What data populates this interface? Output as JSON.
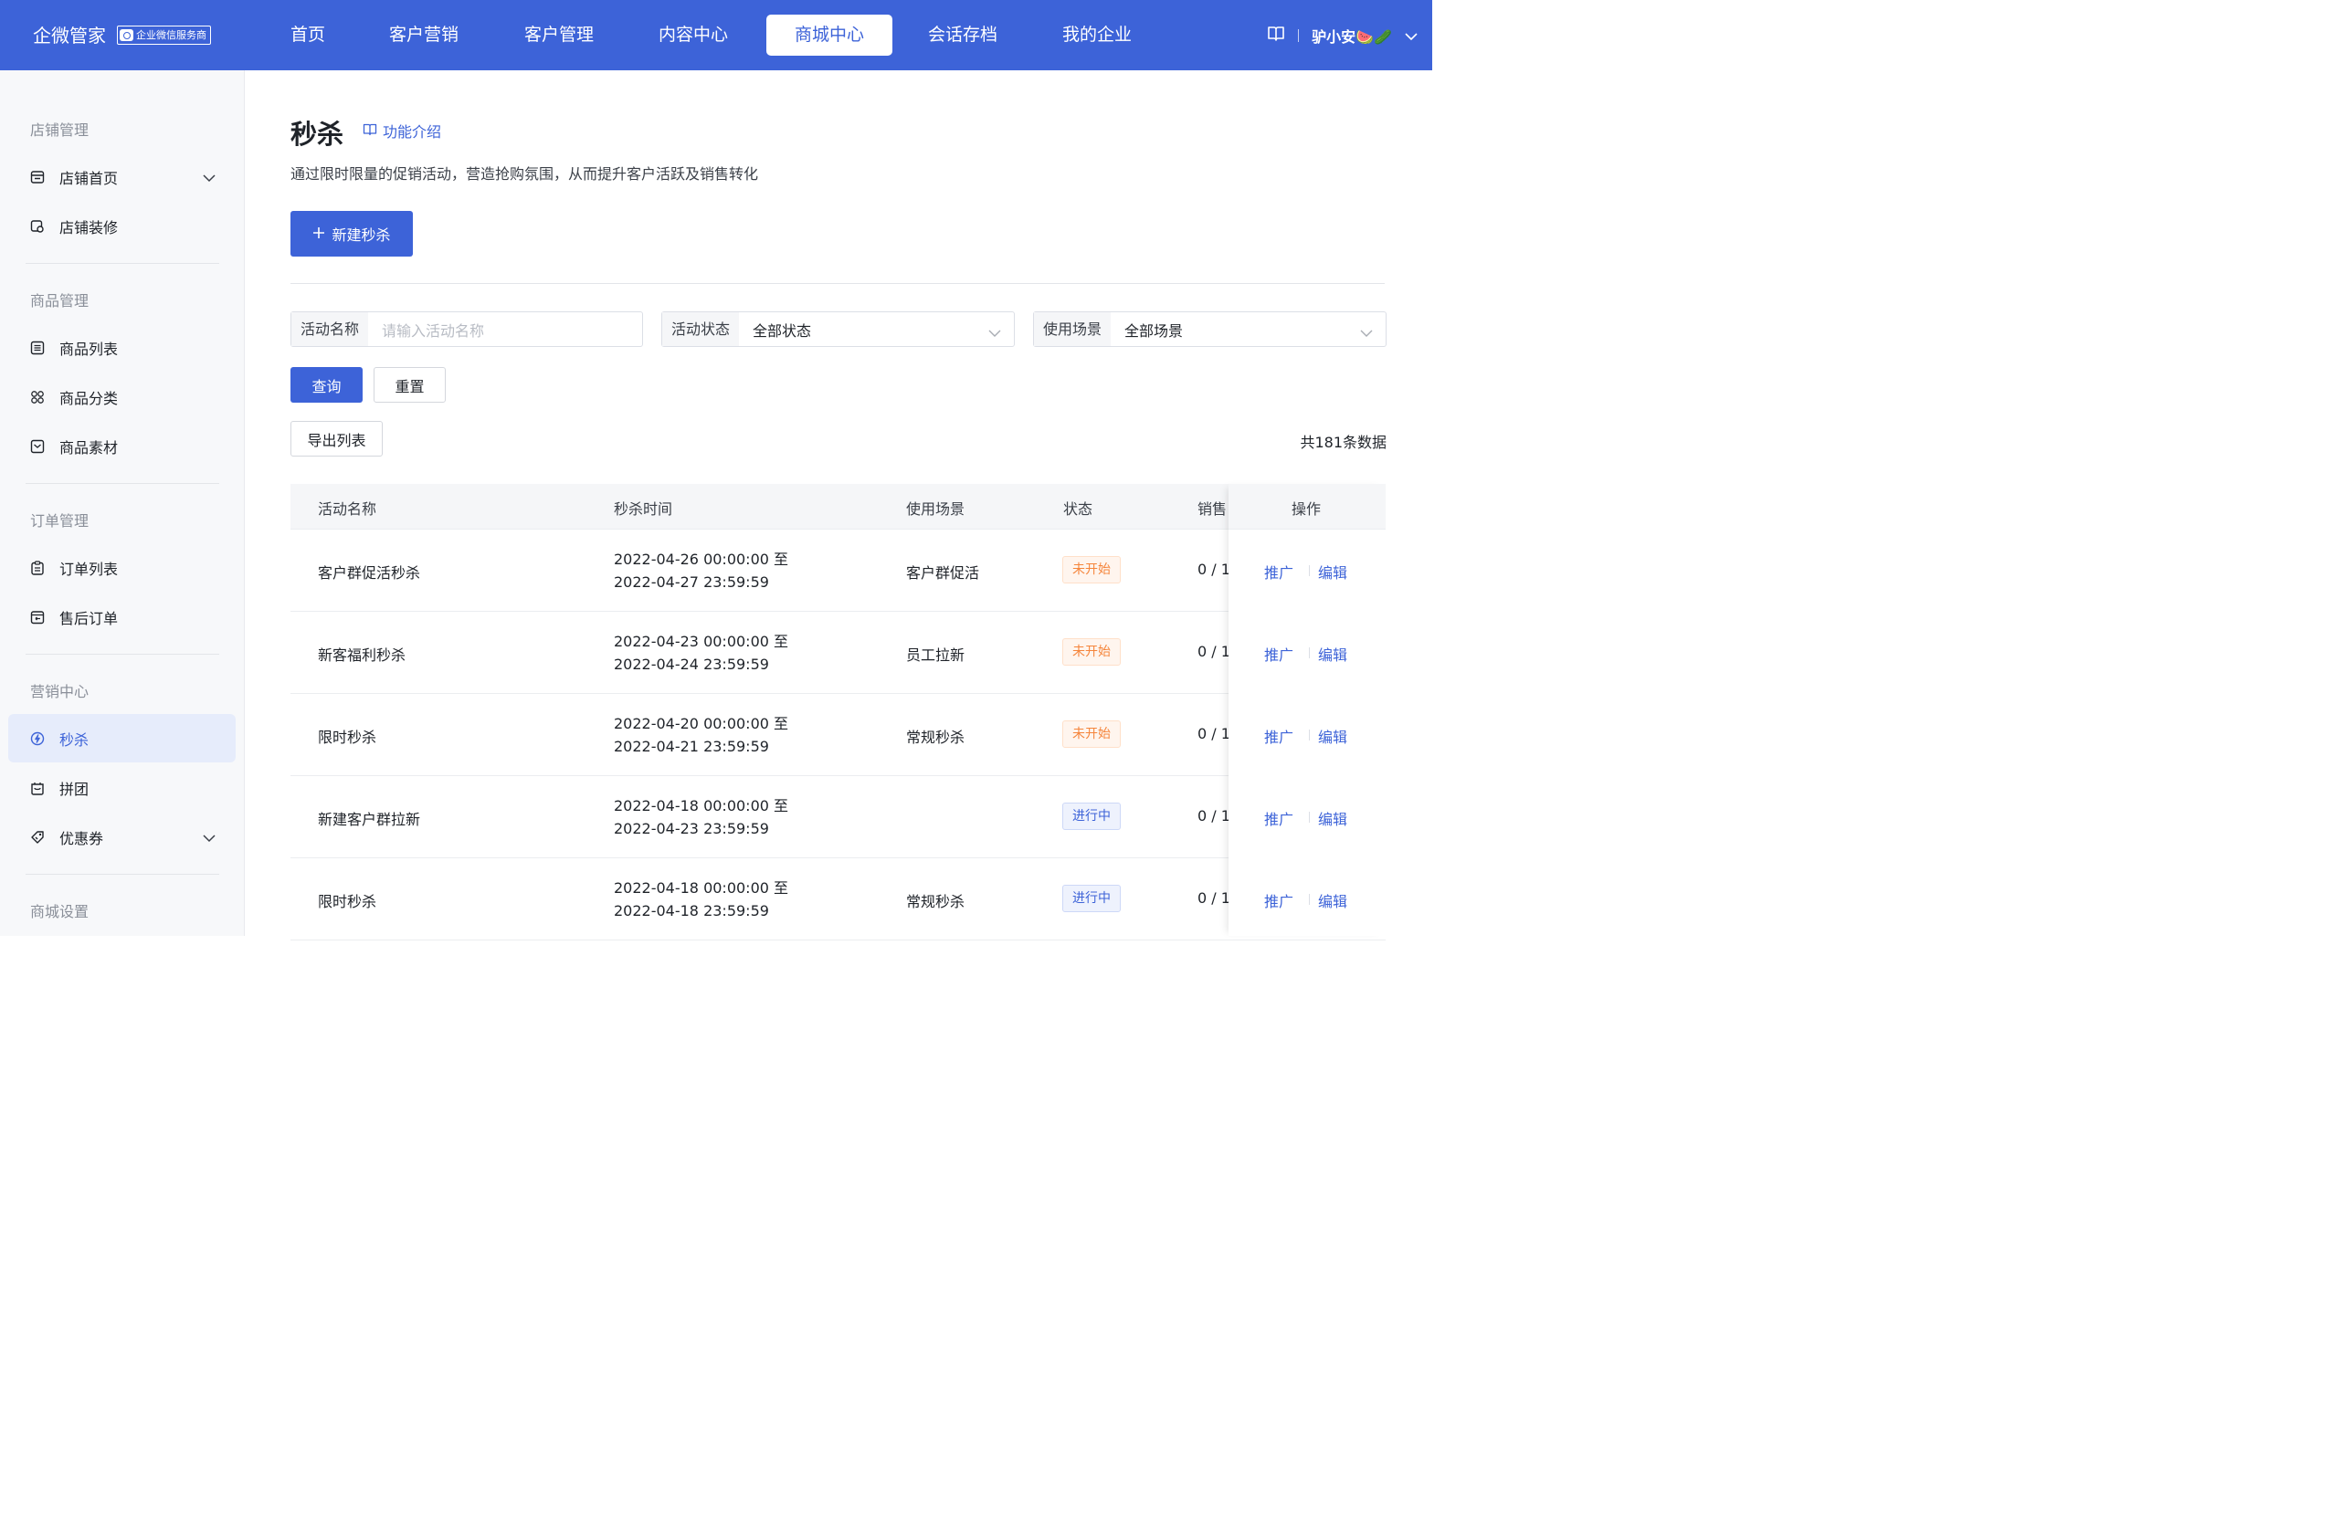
{
  "app": {
    "logo": "企微管家",
    "badge": "企业微信服务商"
  },
  "nav": [
    {
      "label": "首页"
    },
    {
      "label": "客户营销"
    },
    {
      "label": "客户管理"
    },
    {
      "label": "内容中心"
    },
    {
      "label": "商城中心"
    },
    {
      "label": "会话存档"
    },
    {
      "label": "我的企业"
    }
  ],
  "nav_active": "商城中心",
  "user": {
    "name": "驴小安🍉🥒"
  },
  "sidebar": {
    "groups": [
      {
        "label": "店铺管理",
        "items": [
          {
            "label": "店铺首页",
            "icon": "store-icon",
            "has_caret": true
          },
          {
            "label": "店铺装修",
            "icon": "decorate-icon"
          }
        ]
      },
      {
        "label": "商品管理",
        "items": [
          {
            "label": "商品列表",
            "icon": "list-icon"
          },
          {
            "label": "商品分类",
            "icon": "category-icon"
          },
          {
            "label": "商品素材",
            "icon": "material-icon"
          }
        ]
      },
      {
        "label": "订单管理",
        "items": [
          {
            "label": "订单列表",
            "icon": "order-icon"
          },
          {
            "label": "售后订单",
            "icon": "aftersale-icon"
          }
        ]
      },
      {
        "label": "营销中心",
        "items": [
          {
            "label": "秒杀",
            "icon": "flash-icon",
            "active": true
          },
          {
            "label": "拼团",
            "icon": "group-buy-icon"
          },
          {
            "label": "优惠券",
            "icon": "coupon-icon",
            "has_caret": true
          }
        ]
      },
      {
        "label": "商城设置",
        "items": []
      }
    ]
  },
  "page": {
    "title": "秒杀",
    "intro_link": "功能介绍",
    "description": "通过限时限量的促销活动，营造抢购氛围，从而提升客户活跃及销售转化",
    "create_button": "新建秒杀"
  },
  "filters": {
    "name": {
      "label": "活动名称",
      "placeholder": "请输入活动名称"
    },
    "status": {
      "label": "活动状态",
      "value": "全部状态"
    },
    "scene": {
      "label": "使用场景",
      "value": "全部场景"
    },
    "query_button": "查询",
    "reset_button": "重置"
  },
  "export_button": "导出列表",
  "total_text": "共181条数据",
  "table": {
    "columns": [
      "活动名称",
      "秒杀时间",
      "使用场景",
      "状态",
      "销售",
      "操作"
    ],
    "rows": [
      {
        "name": "客户群促活秒杀",
        "time_start": "2022-04-26 00:00:00 至",
        "time_end": "2022-04-27 23:59:59",
        "scene": "客户群促活",
        "status": "未开始",
        "status_type": "pending",
        "sales": "0 / 1"
      },
      {
        "name": "新客福利秒杀",
        "time_start": "2022-04-23 00:00:00 至",
        "time_end": "2022-04-24 23:59:59",
        "scene": "员工拉新",
        "status": "未开始",
        "status_type": "pending",
        "sales": "0 / 1"
      },
      {
        "name": "限时秒杀",
        "time_start": "2022-04-20 00:00:00 至",
        "time_end": "2022-04-21 23:59:59",
        "scene": "常规秒杀",
        "status": "未开始",
        "status_type": "pending",
        "sales": "0 / 1"
      },
      {
        "name": "新建客户群拉新",
        "time_start": "2022-04-18 00:00:00 至",
        "time_end": "2022-04-23 23:59:59",
        "scene": "",
        "status": "进行中",
        "status_type": "running",
        "sales": "0 / 1"
      },
      {
        "name": "限时秒杀",
        "time_start": "2022-04-18 00:00:00 至",
        "time_end": "2022-04-18 23:59:59",
        "scene": "常规秒杀",
        "status": "进行中",
        "status_type": "running",
        "sales": "0 / 1"
      }
    ],
    "actions": {
      "promote": "推广",
      "edit": "编辑"
    }
  },
  "colors": {
    "brand": "#3d63d8",
    "pending": "#f5853b",
    "running": "#3d63d8"
  }
}
